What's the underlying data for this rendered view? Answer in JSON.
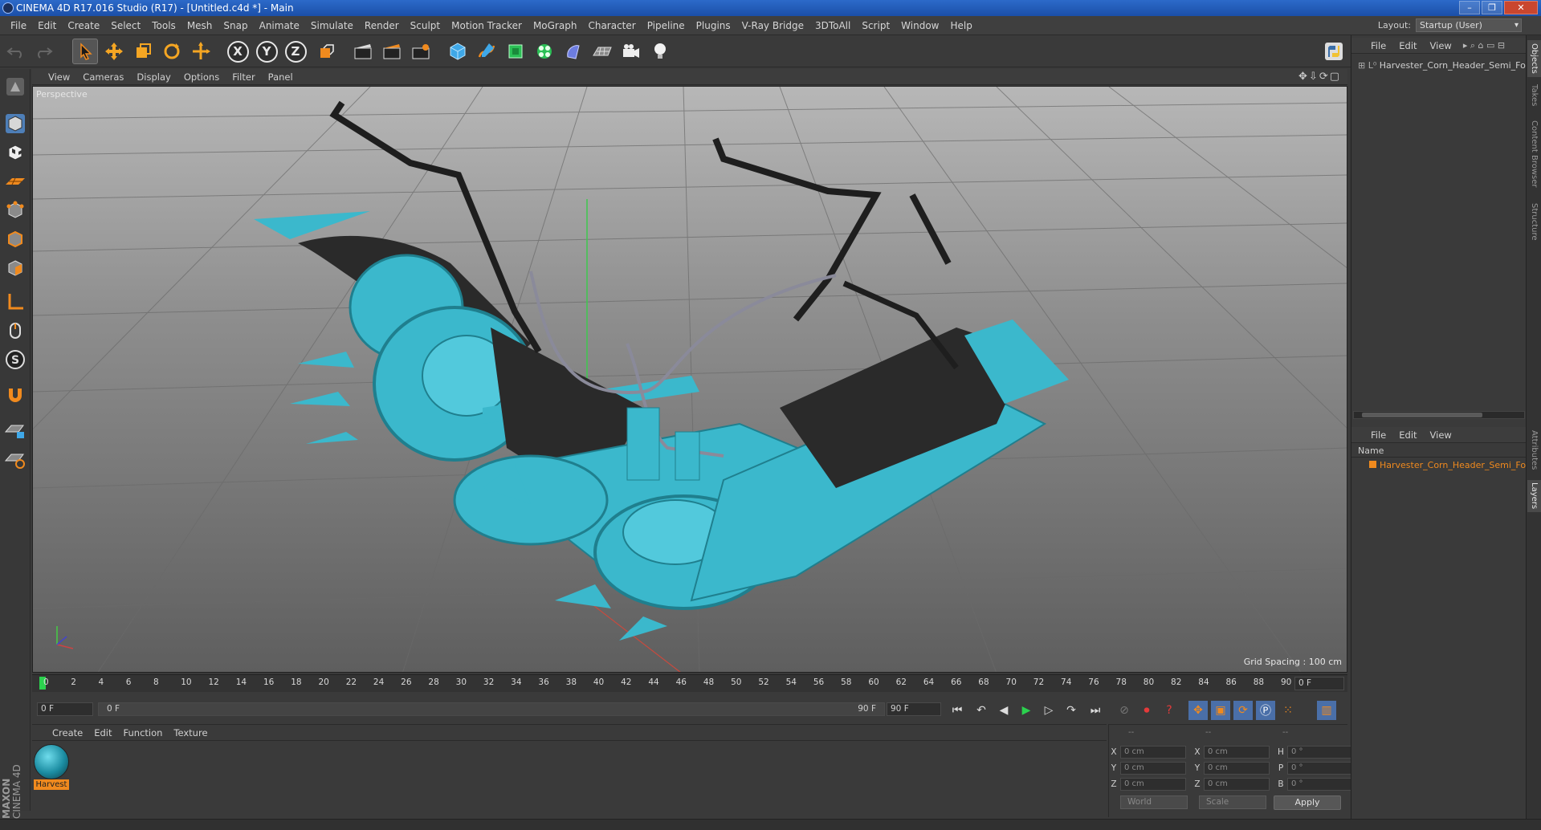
{
  "window": {
    "title": "CINEMA 4D R17.016 Studio (R17) - [Untitled.c4d *] - Main",
    "layout_label": "Layout:",
    "layout_value": "Startup (User)"
  },
  "menubar": [
    "File",
    "Edit",
    "Create",
    "Select",
    "Tools",
    "Mesh",
    "Snap",
    "Animate",
    "Simulate",
    "Render",
    "Sculpt",
    "Motion Tracker",
    "MoGraph",
    "Character",
    "Pipeline",
    "Plugins",
    "V-Ray Bridge",
    "3DToAll",
    "Script",
    "Window",
    "Help"
  ],
  "viewport": {
    "menu": [
      "View",
      "Cameras",
      "Display",
      "Options",
      "Filter",
      "Panel"
    ],
    "label": "Perspective",
    "grid_spacing": "Grid Spacing : 100 cm"
  },
  "timeline": {
    "ticks": [
      "0",
      "2",
      "4",
      "6",
      "8",
      "10",
      "12",
      "14",
      "16",
      "18",
      "20",
      "22",
      "24",
      "26",
      "28",
      "30",
      "32",
      "34",
      "36",
      "38",
      "40",
      "42",
      "44",
      "46",
      "48",
      "50",
      "52",
      "54",
      "56",
      "58",
      "60",
      "62",
      "64",
      "66",
      "68",
      "70",
      "72",
      "74",
      "76",
      "78",
      "80",
      "82",
      "84",
      "86",
      "88",
      "90"
    ],
    "current_frame": "0 F",
    "start_field": "0 F",
    "range_start": "0 F",
    "range_end": "90 F",
    "end_field": "90 F"
  },
  "material_panel": {
    "menu": [
      "Create",
      "Edit",
      "Function",
      "Texture"
    ],
    "material_name": "Harvest"
  },
  "coordinates": {
    "headers": [
      "--",
      "--",
      "--"
    ],
    "rows": [
      {
        "a": "X",
        "av": "0 cm",
        "b": "X",
        "bv": "0 cm",
        "c": "H",
        "cv": "0 °"
      },
      {
        "a": "Y",
        "av": "0 cm",
        "b": "Y",
        "bv": "0 cm",
        "c": "P",
        "cv": "0 °"
      },
      {
        "a": "Z",
        "av": "0 cm",
        "b": "Z",
        "bv": "0 cm",
        "c": "B",
        "cv": "0 °"
      }
    ],
    "world": "World",
    "scale": "Scale",
    "apply": "Apply"
  },
  "objects_panel": {
    "menu": [
      "File",
      "Edit",
      "View"
    ],
    "item": "Harvester_Corn_Header_Semi_Fold"
  },
  "layers_panel": {
    "menu": [
      "File",
      "Edit",
      "View"
    ],
    "column": "Name",
    "item": "Harvester_Corn_Header_Semi_Fold"
  },
  "right_tabs": [
    "Objects",
    "Takes",
    "Content Browser",
    "Structure",
    "Attributes",
    "Layers"
  ],
  "logo": {
    "line1": "MAXON",
    "line2": "CINEMA 4D"
  },
  "colors": {
    "accent": "#f08a1e",
    "model": "#3bb8cc",
    "title_bar": "#1f56b0"
  }
}
